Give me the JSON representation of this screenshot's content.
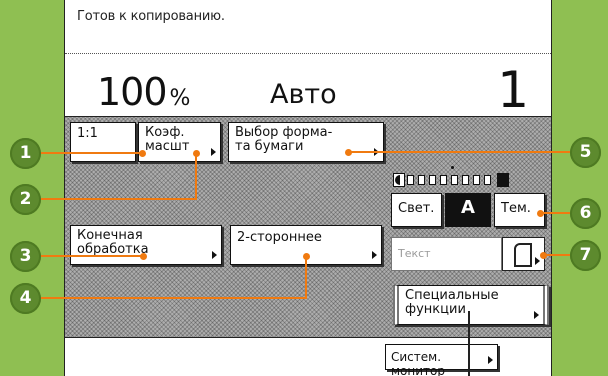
{
  "status_text": "Готов к копированию.",
  "ratio_value": "100",
  "ratio_unit": "%",
  "paper_select": "Авто",
  "copies_count": "1",
  "buttons": {
    "direct_ratio": "1:1",
    "zoom_line1": "Коэф.",
    "zoom_line2": "масшт",
    "paper_line1": "Выбор форма-",
    "paper_line2": "та бумаги",
    "finishing_line1": "Конечная",
    "finishing_line2": "обработка",
    "duplex": "2-стороннее",
    "special_line1": "Специальные",
    "special_line2": "функции",
    "system_monitor": "Систем. монитор"
  },
  "density": {
    "light": "Свет.",
    "auto": "A",
    "dark": "Тем.",
    "level_cells": 8
  },
  "image_mode": "Текст",
  "callouts": [
    "1",
    "2",
    "3",
    "4",
    "5",
    "6",
    "7"
  ],
  "colors": {
    "background": "#8fbf52",
    "callout": "#5d8a2e",
    "marker": "#f07a10"
  },
  "icons": {
    "original_type": "document-page-icon",
    "light_end": "half-moon-icon",
    "dark_end": "filled-square-icon"
  }
}
